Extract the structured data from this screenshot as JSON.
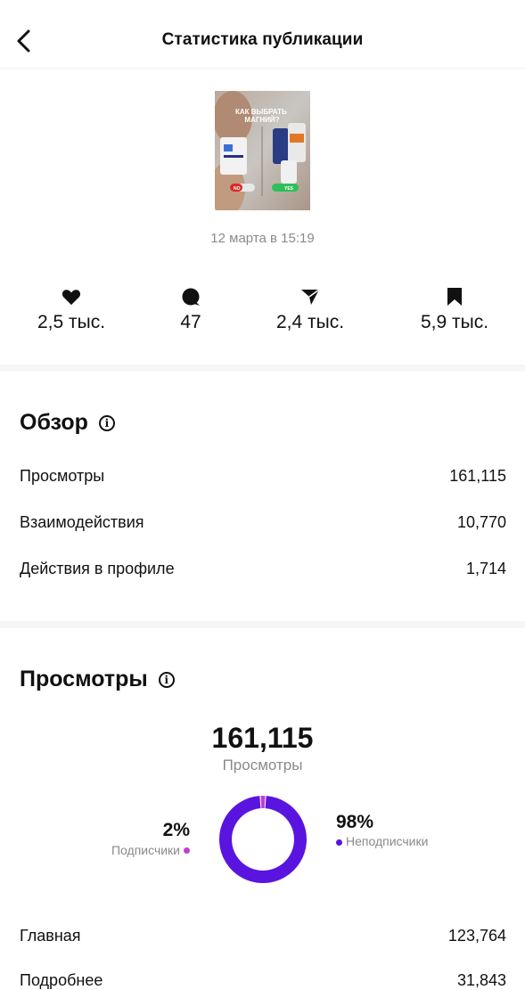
{
  "header": {
    "title": "Статистика публикации"
  },
  "post": {
    "thumbnail_text": "КАК ВЫБРАТЬ МАГНИЙ?",
    "thumbnail_no": "NO",
    "thumbnail_yes": "YES",
    "date": "12 марта в 15:19"
  },
  "metrics": [
    {
      "icon": "heart-icon",
      "value": "2,5 тыс."
    },
    {
      "icon": "comment-icon",
      "value": "47"
    },
    {
      "icon": "send-icon",
      "value": "2,4 тыс."
    },
    {
      "icon": "bookmark-icon",
      "value": "5,9 тыс."
    }
  ],
  "overview": {
    "title": "Обзор",
    "rows": [
      {
        "label": "Просмотры",
        "value": "161,115"
      },
      {
        "label": "Взаимодействия",
        "value": "10,770"
      },
      {
        "label": "Действия в профиле",
        "value": "1,714"
      }
    ]
  },
  "views": {
    "title": "Просмотры",
    "total": "161,115",
    "total_label": "Просмотры",
    "followers_pct": "2%",
    "followers_label": "Подписчики",
    "followers_fraction": 0.02,
    "nonfollowers_pct": "98%",
    "nonfollowers_label": "Неподписчики",
    "nonfollowers_fraction": 0.98,
    "rows": [
      {
        "label": "Главная",
        "value": "123,764"
      },
      {
        "label": "Подробнее",
        "value": "31,843"
      }
    ]
  },
  "colors": {
    "followers": "#c13fd0",
    "nonfollowers": "#5a14e0",
    "divider": "#f6f6f6"
  }
}
